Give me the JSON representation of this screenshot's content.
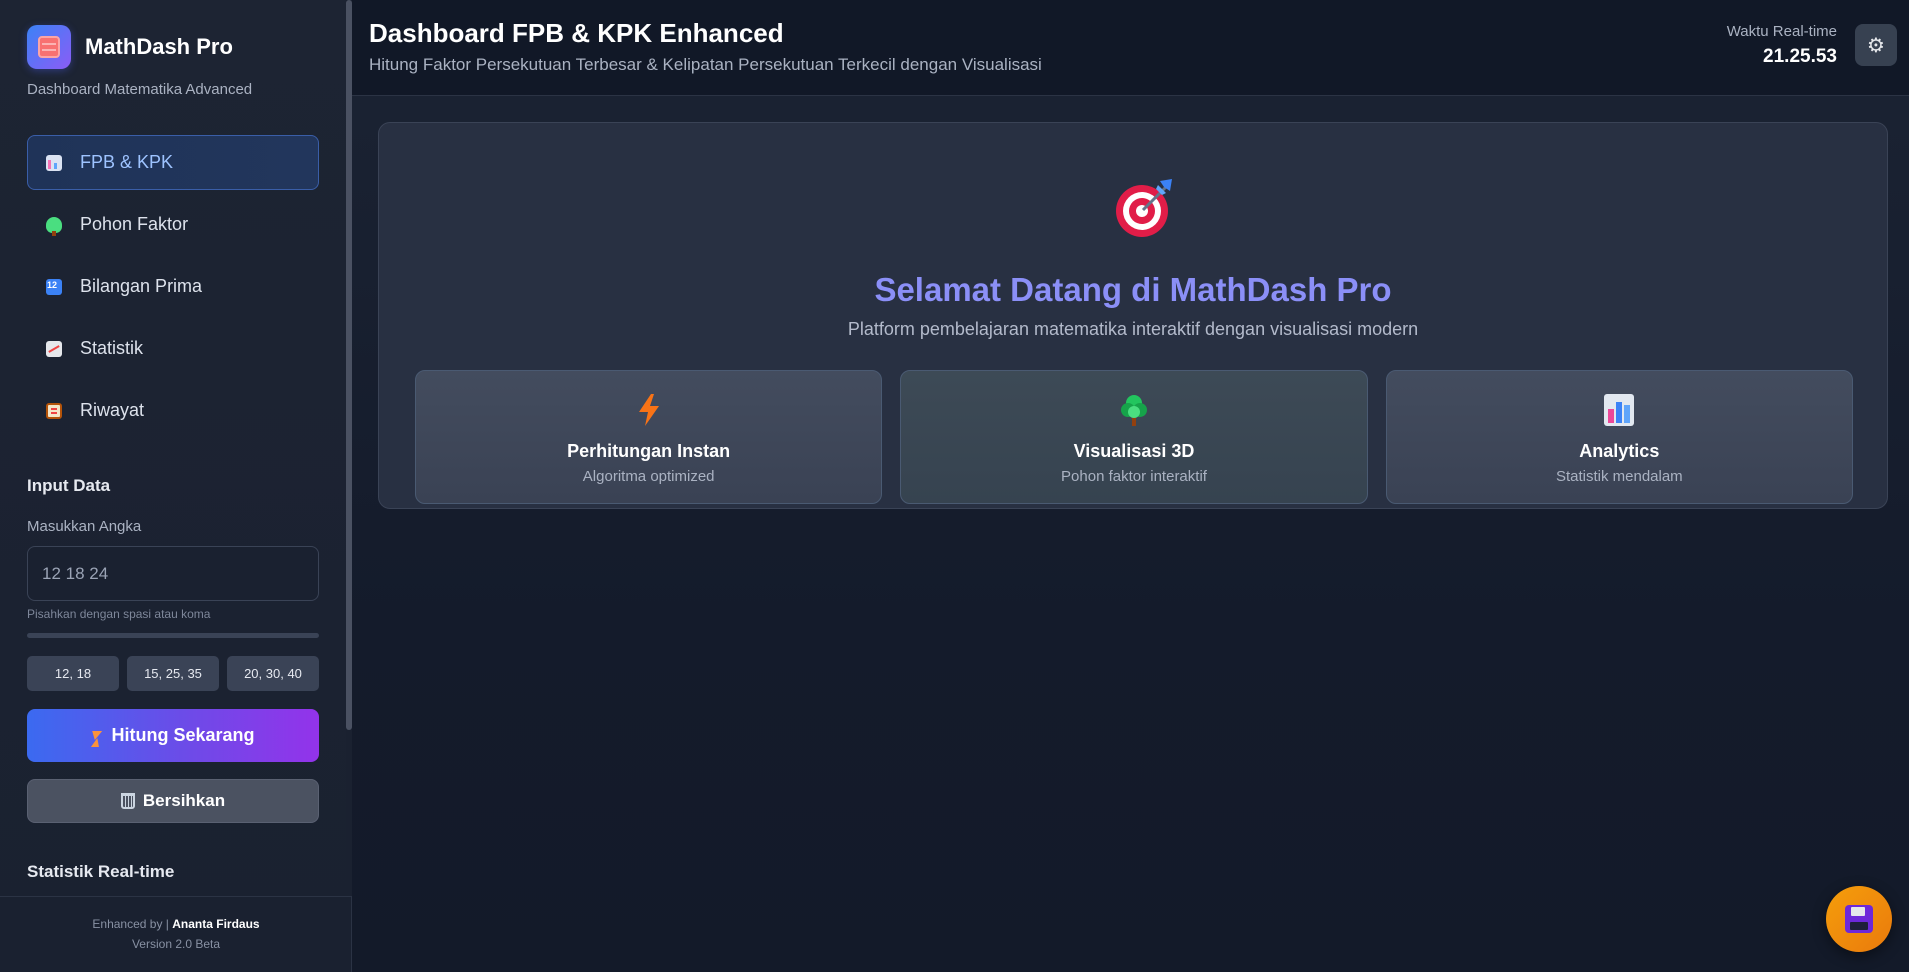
{
  "brand": {
    "name": "MathDash Pro",
    "subtitle": "Dashboard Matematika Advanced"
  },
  "nav": {
    "items": [
      {
        "label": "FPB & KPK",
        "icon": "bar-chart-icon",
        "active": true
      },
      {
        "label": "Pohon Faktor",
        "icon": "tree-icon",
        "active": false
      },
      {
        "label": "Bilangan Prima",
        "icon": "numbers-icon",
        "active": false
      },
      {
        "label": "Statistik",
        "icon": "trend-chart-icon",
        "active": false
      },
      {
        "label": "Riwayat",
        "icon": "clipboard-icon",
        "active": false
      }
    ]
  },
  "input_section": {
    "title": "Input Data",
    "field_label": "Masukkan Angka",
    "placeholder": "12 18 24",
    "hint": "Pisahkan dengan spasi atau koma",
    "presets": [
      "12, 18",
      "15, 25, 35",
      "20, 30, 40"
    ],
    "calculate_label": "Hitung Sekarang",
    "clear_label": "Bersihkan"
  },
  "stats_section": {
    "title": "Statistik Real-time"
  },
  "footer": {
    "enhanced_prefix": "Enhanced by | ",
    "author": "Ananta Firdaus",
    "version": "Version 2.0 Beta"
  },
  "header": {
    "title": "Dashboard FPB & KPK Enhanced",
    "subtitle": "Hitung Faktor Persekutuan Terbesar & Kelipatan Persekutuan Terkecil dengan Visualisasi",
    "clock_label": "Waktu Real-time",
    "clock_value": "21.25.53"
  },
  "welcome": {
    "title": "Selamat Datang di MathDash Pro",
    "subtitle": "Platform pembelajaran matematika interaktif dengan visualisasi modern",
    "features": [
      {
        "title": "Perhitungan Instan",
        "subtitle": "Algoritma optimized",
        "icon": "lightning-icon"
      },
      {
        "title": "Visualisasi 3D",
        "subtitle": "Pohon faktor interaktif",
        "icon": "tree-icon"
      },
      {
        "title": "Analytics",
        "subtitle": "Statistik mendalam",
        "icon": "bar-chart-icon"
      }
    ]
  },
  "colors": {
    "accent_blue": "#3b6af0",
    "accent_purple": "#9333ea",
    "welcome_title": "#8b8ff7",
    "fab": "#f59e0b"
  }
}
